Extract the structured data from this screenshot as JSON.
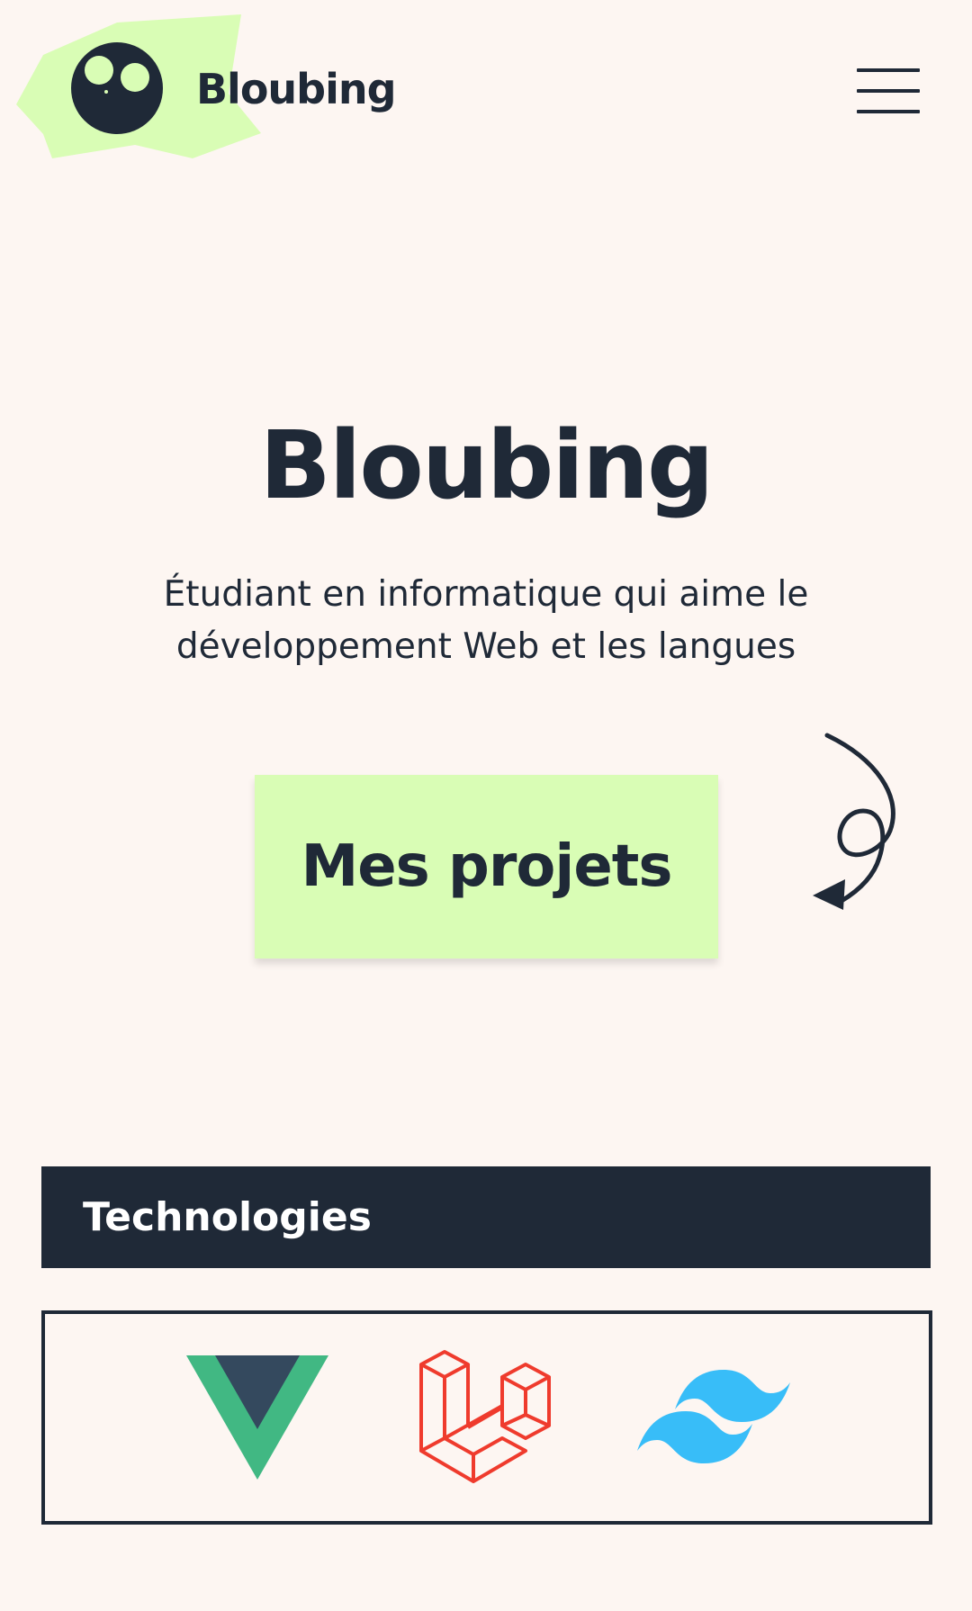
{
  "header": {
    "site_name": "Bloubing",
    "menu_icon": "hamburger-icon"
  },
  "hero": {
    "title": "Bloubing",
    "subtitle": "Étudiant en informatique qui aime le développement Web et les langues",
    "cta_label": "Mes projets",
    "decoration_icon": "swirl-arrow-icon"
  },
  "technologies": {
    "heading": "Technologies",
    "items": [
      {
        "name": "Vue.js",
        "icon": "vue-icon"
      },
      {
        "name": "Laravel",
        "icon": "laravel-icon"
      },
      {
        "name": "Tailwind CSS",
        "icon": "tailwind-icon"
      }
    ]
  },
  "colors": {
    "background": "#fdf6f2",
    "primary_dark": "#1f2937",
    "accent_green": "#d9fdb5",
    "vue_green": "#41b883",
    "vue_dark": "#34495e",
    "laravel_red": "#ef3b2d",
    "tailwind_blue": "#38bdf8"
  }
}
